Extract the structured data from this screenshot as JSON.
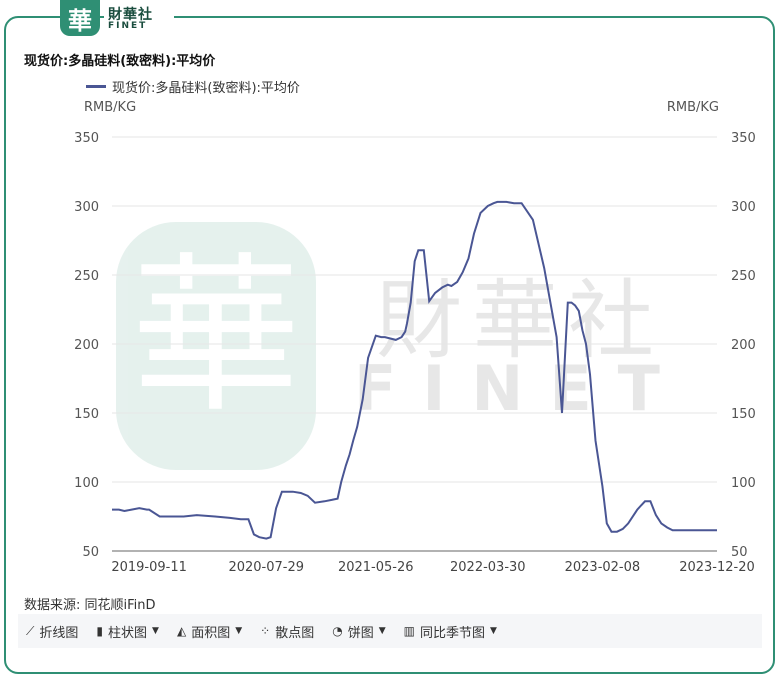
{
  "brand": {
    "logo_char": "華",
    "name_cn": "財華社",
    "name_en": "FINET"
  },
  "title": "现货价:多晶硅料(致密料):平均价",
  "legend_label": "现货价:多晶硅料(致密料):平均价",
  "unit_left": "RMB/KG",
  "unit_right": "RMB/KG",
  "source": "数据来源: 同花顺iFinD",
  "toolbar": [
    {
      "label": "折线图",
      "icon": "line-chart-icon",
      "dropdown": false
    },
    {
      "label": "柱状图",
      "icon": "bar-chart-icon",
      "dropdown": true
    },
    {
      "label": "面积图",
      "icon": "area-chart-icon",
      "dropdown": true
    },
    {
      "label": "散点图",
      "icon": "scatter-chart-icon",
      "dropdown": false
    },
    {
      "label": "饼图",
      "icon": "pie-chart-icon",
      "dropdown": true
    },
    {
      "label": "同比季节图",
      "icon": "seasonal-chart-icon",
      "dropdown": true
    }
  ],
  "colors": {
    "line": "#4a5694",
    "frame": "#2f8f74",
    "grid": "#e6e6e6"
  },
  "chart_data": {
    "type": "line",
    "series": [
      {
        "name": "现货价:多晶硅料(致密料):平均价",
        "x": [
          "2019-06-01",
          "2019-06-20",
          "2019-07-05",
          "2019-07-25",
          "2019-08-15",
          "2019-09-05",
          "2019-09-11",
          "2019-10-10",
          "2019-11-10",
          "2019-12-15",
          "2020-01-20",
          "2020-03-10",
          "2020-04-20",
          "2020-05-20",
          "2020-06-10",
          "2020-06-25",
          "2020-07-10",
          "2020-07-29",
          "2020-08-10",
          "2020-08-25",
          "2020-09-10",
          "2020-10-10",
          "2020-11-01",
          "2020-11-20",
          "2020-12-10",
          "2021-01-05",
          "2021-01-25",
          "2021-02-10",
          "2021-02-20",
          "2021-03-05",
          "2021-03-15",
          "2021-03-25",
          "2021-04-05",
          "2021-04-20",
          "2021-05-05",
          "2021-05-26",
          "2021-06-10",
          "2021-06-20",
          "2021-07-05",
          "2021-07-20",
          "2021-08-05",
          "2021-08-15",
          "2021-08-20",
          "2021-08-30",
          "2021-09-10",
          "2021-09-20",
          "2021-10-05",
          "2021-10-20",
          "2021-11-05",
          "2021-11-25",
          "2021-12-10",
          "2021-12-20",
          "2022-01-05",
          "2022-01-20",
          "2022-02-05",
          "2022-02-20",
          "2022-03-10",
          "2022-03-30",
          "2022-04-15",
          "2022-04-25",
          "2022-05-05",
          "2022-05-20",
          "2022-06-10",
          "2022-07-01",
          "2022-08-01",
          "2022-09-01",
          "2022-10-05",
          "2022-10-20",
          "2022-11-05",
          "2022-11-15",
          "2022-11-25",
          "2022-12-05",
          "2022-12-15",
          "2022-12-25",
          "2023-01-05",
          "2023-01-20",
          "2023-02-08",
          "2023-02-20",
          "2023-03-05",
          "2023-03-20",
          "2023-04-05",
          "2023-04-20",
          "2023-05-05",
          "2023-05-15",
          "2023-05-25",
          "2023-06-05",
          "2023-06-20",
          "2023-07-05",
          "2023-07-20",
          "2023-08-05",
          "2023-08-20",
          "2023-09-05",
          "2023-09-15",
          "2023-09-25",
          "2023-10-10",
          "2023-10-25",
          "2023-11-10",
          "2023-11-25",
          "2023-12-10",
          "2023-12-20"
        ],
        "y": [
          80,
          80,
          79,
          80,
          81,
          80,
          80,
          75,
          75,
          75,
          76,
          75,
          74,
          73,
          73,
          62,
          60,
          59,
          60,
          81,
          93,
          93,
          92,
          90,
          85,
          86,
          87,
          88,
          100,
          112,
          120,
          130,
          140,
          160,
          190,
          206,
          205,
          205,
          204,
          203,
          205,
          209,
          215,
          230,
          260,
          268,
          268,
          231,
          237,
          241,
          243,
          242,
          245,
          252,
          262,
          280,
          295,
          300,
          302,
          303,
          303,
          303,
          302,
          302,
          290,
          255,
          205,
          150,
          230,
          230,
          228,
          224,
          210,
          200,
          178,
          130,
          97,
          70,
          64,
          64,
          66,
          70,
          76,
          80,
          83,
          86,
          86,
          76,
          70,
          67,
          65,
          65,
          65,
          65,
          65,
          65,
          65,
          65,
          65,
          65
        ]
      }
    ],
    "x_ticks": [
      "2019-09-11",
      "2020-07-29",
      "2021-05-26",
      "2022-03-30",
      "2023-02-08",
      "2023-12-20"
    ],
    "y_ticks": [
      50,
      100,
      150,
      200,
      250,
      300,
      350
    ],
    "ylim": [
      50,
      350
    ],
    "grid": true,
    "legend_position": "top-left"
  }
}
